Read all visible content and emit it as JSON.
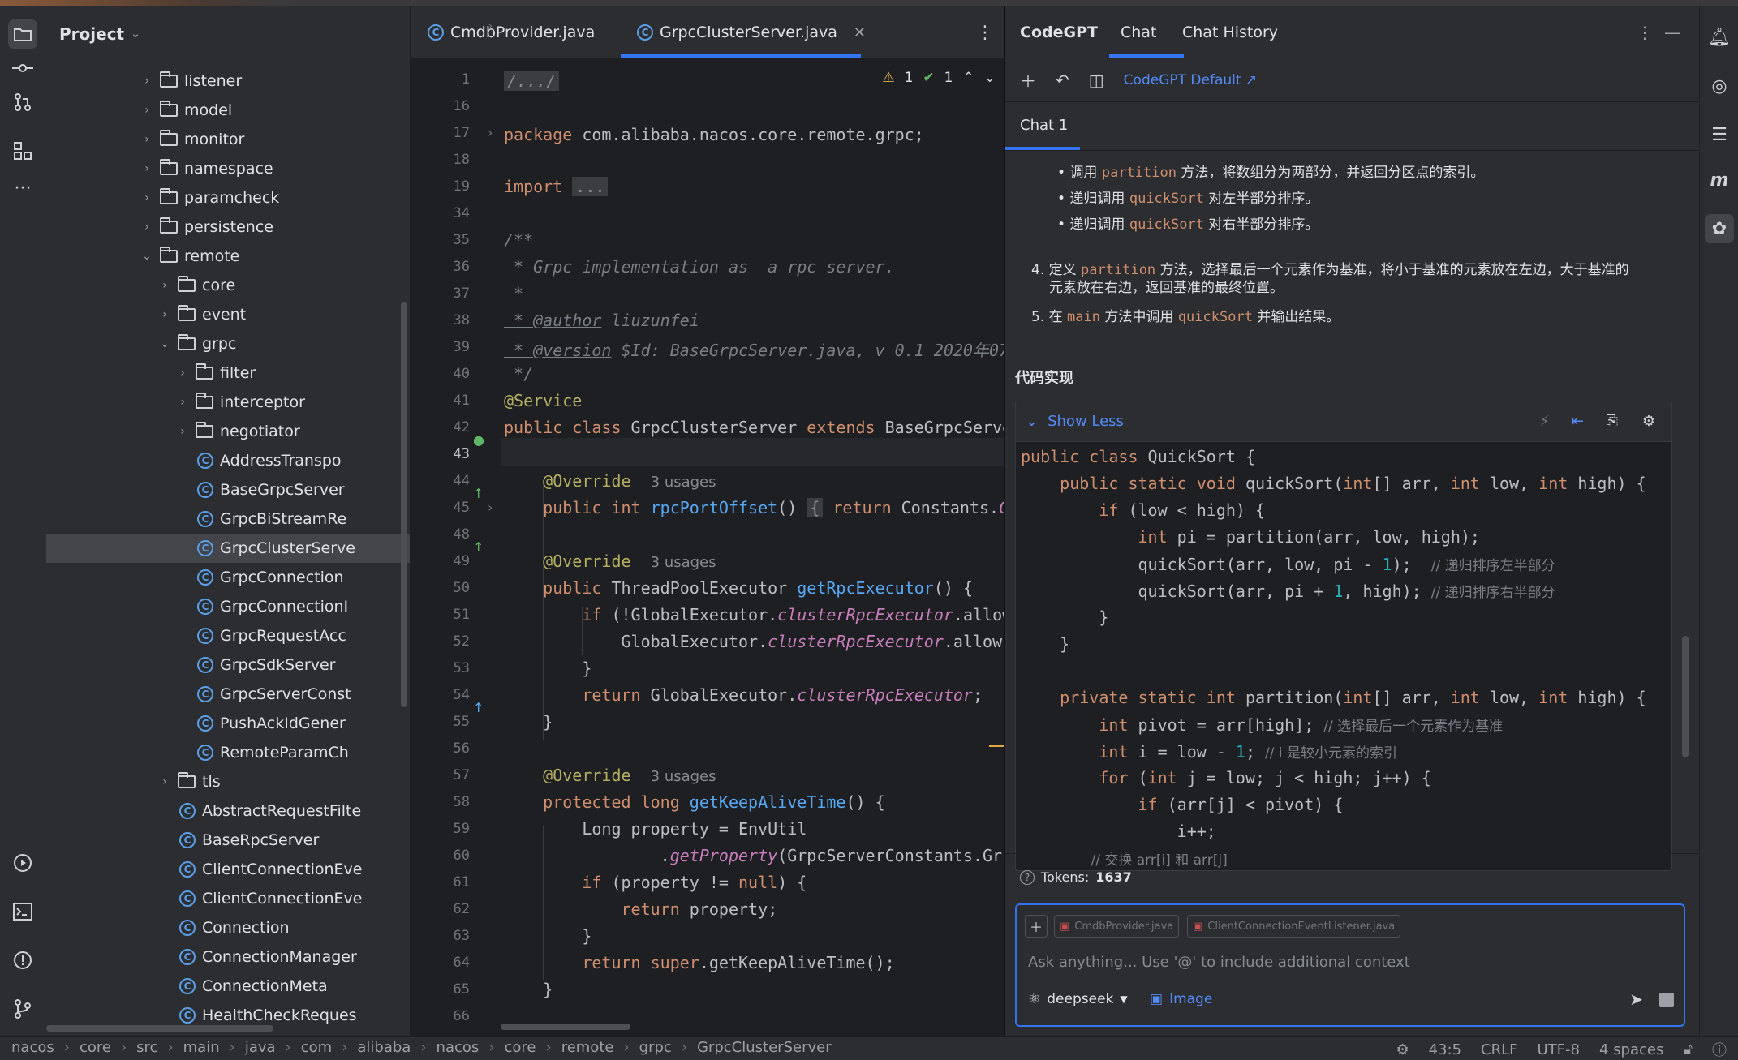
{
  "project_panel": {
    "title": "Project",
    "tree": [
      {
        "label": "listener",
        "type": "folder"
      },
      {
        "label": "model",
        "type": "folder"
      },
      {
        "label": "monitor",
        "type": "folder"
      },
      {
        "label": "namespace",
        "type": "folder"
      },
      {
        "label": "paramcheck",
        "type": "folder"
      },
      {
        "label": "persistence",
        "type": "folder"
      },
      {
        "label": "remote",
        "type": "folder",
        "expanded": true
      },
      {
        "label": "core",
        "type": "folder"
      },
      {
        "label": "event",
        "type": "folder"
      },
      {
        "label": "grpc",
        "type": "folder",
        "expanded": true
      },
      {
        "label": "filter",
        "type": "folder"
      },
      {
        "label": "interceptor",
        "type": "folder"
      },
      {
        "label": "negotiator",
        "type": "folder"
      },
      {
        "label": "AddressTranspo",
        "type": "class"
      },
      {
        "label": "BaseGrpcServer",
        "type": "class"
      },
      {
        "label": "GrpcBiStreamRe",
        "type": "class"
      },
      {
        "label": "GrpcClusterServe",
        "type": "class",
        "selected": true
      },
      {
        "label": "GrpcConnection",
        "type": "class"
      },
      {
        "label": "GrpcConnectionI",
        "type": "class"
      },
      {
        "label": "GrpcRequestAcc",
        "type": "class"
      },
      {
        "label": "GrpcSdkServer",
        "type": "class"
      },
      {
        "label": "GrpcServerConst",
        "type": "class"
      },
      {
        "label": "PushAckIdGener",
        "type": "class"
      },
      {
        "label": "RemoteParamCh",
        "type": "class"
      },
      {
        "label": "tls",
        "type": "folder"
      },
      {
        "label": "AbstractRequestFilte",
        "type": "class"
      },
      {
        "label": "BaseRpcServer",
        "type": "class"
      },
      {
        "label": "ClientConnectionEve",
        "type": "class"
      },
      {
        "label": "ClientConnectionEve",
        "type": "class"
      },
      {
        "label": "Connection",
        "type": "class"
      },
      {
        "label": "ConnectionManager",
        "type": "class"
      },
      {
        "label": "ConnectionMeta",
        "type": "class"
      },
      {
        "label": "HealthCheckReques",
        "type": "class"
      }
    ]
  },
  "editor": {
    "tabs": [
      {
        "label": "CmdbProvider.java",
        "active": false
      },
      {
        "label": "GrpcClusterServer.java",
        "active": true
      }
    ],
    "inspections": {
      "warnings": "1",
      "checks": "1"
    },
    "line_numbers": [
      "1",
      "16",
      "17",
      "18",
      "19",
      "34",
      "35",
      "36",
      "37",
      "38",
      "39",
      "40",
      "41",
      "42",
      "43",
      "44",
      "45",
      "48",
      "49",
      "50",
      "51",
      "52",
      "53",
      "54",
      "55",
      "56",
      "57",
      "58",
      "59",
      "60",
      "61",
      "62",
      "63",
      "64",
      "65",
      "66"
    ],
    "code": {
      "l1": "/.../",
      "l17_kw": "package",
      "l17_rest": " com.alibaba.nacos.core.remote.grpc;",
      "l19_kw": "import",
      "l19_fold": "...",
      "l35": "/**",
      "l36": " * Grpc implementation as  a rpc server.",
      "l37": " *",
      "l38_tag": " * @author",
      "l38_rest": " liuzunfei",
      "l39_tag": " * @version",
      "l39_rest": " $Id: BaseGrpcServer.java, v 0.1 2020年07",
      "l40": " */",
      "l41": "@Service",
      "l42_kw1": "public class",
      "l42_mid": " GrpcClusterServer ",
      "l42_kw2": "extends",
      "l42_rest": " BaseGrpcServe",
      "l44_ann": "    @Override",
      "l44_hint": "3 usages",
      "l45_kw": "    public int ",
      "l45_fn": "rpcPortOffset",
      "l45_mid": "() ",
      "l45_fold": "{",
      "l45_kw2": " return",
      "l45_rest": " Constants.",
      "l45_fld": "C",
      "l49_ann": "    @Override",
      "l49_hint": "3 usages",
      "l50_kw": "    public",
      "l50_mid": " ThreadPoolExecutor ",
      "l50_fn": "getRpcExecutor",
      "l50_rest": "() {",
      "l51_kw": "        if",
      "l51_mid": " (!GlobalExecutor.",
      "l51_fld": "clusterRpcExecutor",
      "l51_rest": ".allow",
      "l52_mid": "            GlobalExecutor.",
      "l52_fld": "clusterRpcExecutor",
      "l52_rest": ".allow",
      "l53": "        }",
      "l54_kw": "        return",
      "l54_mid": " GlobalExecutor.",
      "l54_fld": "clusterRpcExecutor",
      "l54_rest": ";",
      "l55": "    }",
      "l57_ann": "    @Override",
      "l57_hint": "3 usages",
      "l58_kw": "    protected long",
      "l58_fn": " getKeepAliveTime",
      "l58_rest": "() {",
      "l59": "        Long property = EnvUtil",
      "l60_mid": "                .",
      "l60_fld": "getProperty",
      "l60_rest": "(GrpcServerConstants.Grp",
      "l61_kw": "        if",
      "l61_mid": " (property != ",
      "l61_kw2": "null",
      "l61_rest": ") {",
      "l62_kw": "            return",
      "l62_rest": " property;",
      "l63": "        }",
      "l64_kw": "        return super",
      "l64_rest": ".getKeepAliveTime();",
      "l65": "    }"
    }
  },
  "codegpt": {
    "tabs": [
      "CodeGPT",
      "Chat",
      "Chat History"
    ],
    "active_tab": "Chat",
    "config_link": "CodeGPT Default ↗",
    "chat_tab": "Chat 1",
    "bullets": [
      {
        "pre": "调用 ",
        "code": "partition",
        "post": " 方法，将数组分为两部分，并返回分区点的索引。"
      },
      {
        "pre": "递归调用 ",
        "code": "quickSort",
        "post": " 对左半部分排序。"
      },
      {
        "pre": "递归调用 ",
        "code": "quickSort",
        "post": " 对右半部分排序。"
      }
    ],
    "step4": {
      "num": "4.",
      "pre": "定义 ",
      "code": "partition",
      "post": " 方法，选择最后一个元素作为基准，将小于基准的元素放在左边，大于基准的",
      "line2": "元素放在右边，返回基准的最终位置。"
    },
    "step5": {
      "num": "5.",
      "pre": "在 ",
      "code1": "main",
      "mid": " 方法中调用 ",
      "code2": "quickSort",
      "post": " 并输出结果。"
    },
    "section_title": "代码实现",
    "show_less": "Show Less",
    "code": {
      "c1_kw": "public class",
      "c1_rest": " QuickSort {",
      "c2_kw": "    public static void",
      "c2_mid": " quickSort(",
      "c2_kw2": "int",
      "c2_mid2": "[] arr, ",
      "c2_kw3": "int",
      "c2_mid3": " low, ",
      "c2_kw4": "int",
      "c2_rest": " high) {",
      "c3_kw": "        if",
      "c3_rest": " (low < high) {",
      "c4_kw": "            int",
      "c4_rest": " pi = partition(arr, low, high);",
      "c5_mid": "            quickSort(arr, low, pi - ",
      "c5_num": "1",
      "c5_rest": ");  ",
      "c5_cmt": "// 递归排序左半部分",
      "c6_mid": "            quickSort(arr, pi + ",
      "c6_num": "1",
      "c6_rest": ", high); ",
      "c6_cmt": "// 递归排序右半部分",
      "c7": "        }",
      "c8": "    }",
      "c9_kw": "    private static int",
      "c9_mid": " partition(",
      "c9_kw2": "int",
      "c9_mid2": "[] arr, ",
      "c9_kw3": "int",
      "c9_mid3": " low, ",
      "c9_kw4": "int",
      "c9_rest": " high) {",
      "c10_kw": "        int",
      "c10_rest": " pivot = arr[high]; ",
      "c10_cmt": "// 选择最后一个元素作为基准",
      "c11_kw": "        int",
      "c11_mid": " i = low - ",
      "c11_num": "1",
      "c11_rest": "; ",
      "c11_cmt": "// i 是较小元素的索引",
      "c12_kw": "        for",
      "c12_mid": " (",
      "c12_kw2": "int",
      "c12_rest": " j = low; j < high; j++) {",
      "c13_kw": "            if",
      "c13_rest": " (arr[j] < pivot) {",
      "c14": "                i++;",
      "c15_cmt": "                // 交换 arr[i] 和 arr[j]"
    },
    "tokens_label": "Tokens:",
    "tokens_value": "1637",
    "chips": [
      "CmdbProvider.java",
      "ClientConnectionEventListener.java"
    ],
    "placeholder": "Ask anything... Use '@' to include additional context",
    "model": "deepseek",
    "image_btn": "Image"
  },
  "statusbar": {
    "crumbs": [
      "nacos",
      "core",
      "src",
      "main",
      "java",
      "com",
      "alibaba",
      "nacos",
      "core",
      "remote",
      "grpc",
      "GrpcClusterServer"
    ],
    "position": "43:5",
    "line_sep": "CRLF",
    "encoding": "UTF-8",
    "indent": "4 spaces"
  }
}
